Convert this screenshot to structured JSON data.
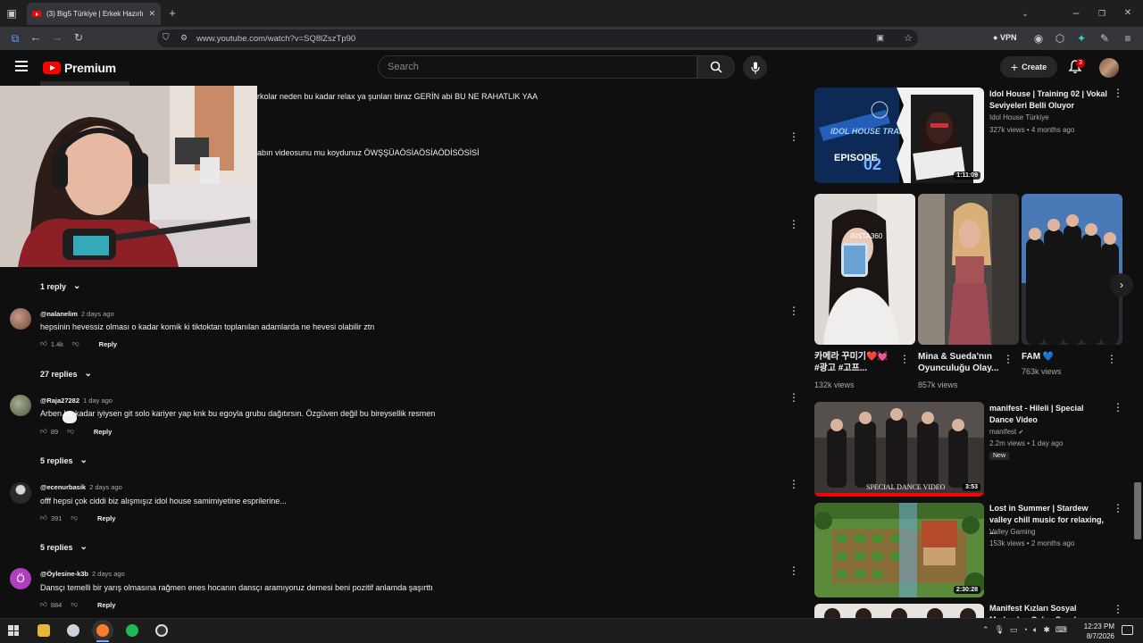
{
  "browser": {
    "tab_title": "(3) Big5 Türkiye | Erkek Hazırlık",
    "url": "www.youtube.com/watch?v=SQ8lZszTp90",
    "vpn_label": "VPN"
  },
  "masthead": {
    "logo_label": "Premium",
    "search_placeholder": "Search",
    "create_label": "Create",
    "notification_count": "3"
  },
  "comments": {
    "partial1_text": "rkolar neden bu kadar relax ya şunları biraz GERİN abi BU NE RAHATLIK YAA",
    "partial2_text": "abın videosunu mu koydunuz ÖWŞŞÜAÖSİAÖSİAÖDİSÖSİSİ",
    "partial_replies": "1 reply",
    "items": [
      {
        "author": "@nalanelim",
        "time": "2 days ago",
        "text": "hepsinin hevessiz olması o kadar komik ki tiktoktan toplanılan adamlarda ne hevesi olabilir ztn",
        "likes": "1.4k",
        "reply": "Reply",
        "replies": "27 replies",
        "avatar_color": "#8a6a5a"
      },
      {
        "author": "@Raja27282",
        "time": "1 day ago",
        "text": "Arben bu kadar iyiysen git solo kariyer yap knk bu egoyla grubu dağıtırsın. Özgüven değil bu bireysellik resmen",
        "likes": "89",
        "reply": "Reply",
        "replies": "5 replies",
        "avatar_color": "#6d7a5e"
      },
      {
        "author": "@ecenurbasik",
        "time": "2 days ago",
        "text": "offf hepsi çok ciddi biz alışmışız idol house samimiyetine esprilerine...",
        "likes": "391",
        "reply": "Reply",
        "replies": "5 replies",
        "avatar_color": "#3a3a3a"
      },
      {
        "author": "@Öylesine-k3b",
        "time": "2 days ago",
        "text": "Dansçı temelli bir yarış olmasına rağmen enes hocanın dansçı aramıyoruz demesi beni pozitif anlamda şaşırttı",
        "likes": "884",
        "reply": "Reply",
        "replies": "",
        "avatar_color": "#b03fc0",
        "avatar_letter": "Ö"
      }
    ]
  },
  "sidebar": {
    "video1": {
      "title": "Idol House | Training 02 | Vokal Seviyeleri Belli Oluyor",
      "channel": "Idol House Türkiye",
      "meta": "327k views • 4 months ago",
      "duration": "1:11:09",
      "thumb_text": "IDOL HOUSE TRAINING",
      "episode_label": "EPISODE"
    },
    "shorts": [
      {
        "title": "카메라 꾸미기❤️💓 #광고 #고프...",
        "views": "132k views"
      },
      {
        "title": "Mina & Sueda'nın Oyunculuğu Olay...",
        "views": "857k views"
      },
      {
        "title": "FAM 💙",
        "views": "763k views"
      }
    ],
    "video2": {
      "title": "manifest - Hileli | Special Dance Video",
      "channel": "manifest",
      "meta": "2.2m views • 1 day ago",
      "badge": "New",
      "duration": "3:53",
      "thumb_text": "SPECIAL DANCE VIDEO"
    },
    "video3": {
      "title": "Lost in Summer | Stardew valley chill music for relaxing, ...",
      "channel": "Valley Gaming",
      "meta": "153k views • 2 months ago",
      "duration": "2:30:28"
    },
    "video4": {
      "title": "Manifest Kızları Sosyal Medyadan Gelen Soruları..."
    }
  },
  "taskbar": {
    "time": "12:23 PM",
    "date": "8/7/2026"
  }
}
